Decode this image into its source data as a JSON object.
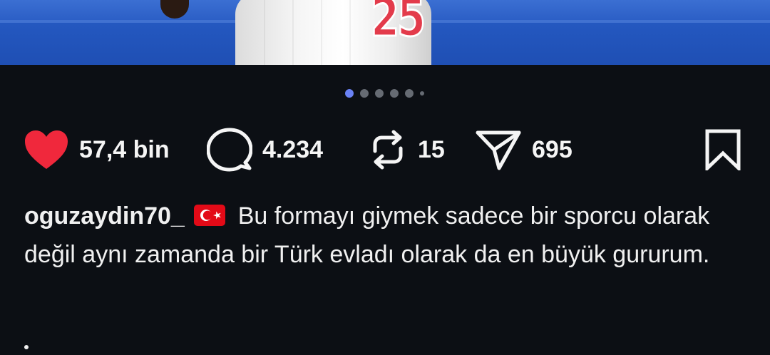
{
  "post": {
    "carousel": {
      "total": 6,
      "active_index": 0
    },
    "actions": {
      "likes": "57,4 bin",
      "comments": "4.234",
      "reposts": "15",
      "shares": "695"
    },
    "caption": {
      "username": "oguzaydin70_",
      "text": "Bu formayı giymek sadece bir sporcu olarak değil aynı zamanda bir Türk evladı olarak da en büyük gururum."
    },
    "photo": {
      "jersey_number": "25"
    }
  },
  "colors": {
    "background": "#0c0f14",
    "like_red": "#f0283c",
    "active_dot": "#6a82f5",
    "inactive_dot": "#666b73",
    "flag_red": "#e30a17"
  },
  "icons": [
    "heart-icon",
    "comment-icon",
    "repost-icon",
    "share-icon",
    "bookmark-icon",
    "turkey-flag-icon"
  ]
}
